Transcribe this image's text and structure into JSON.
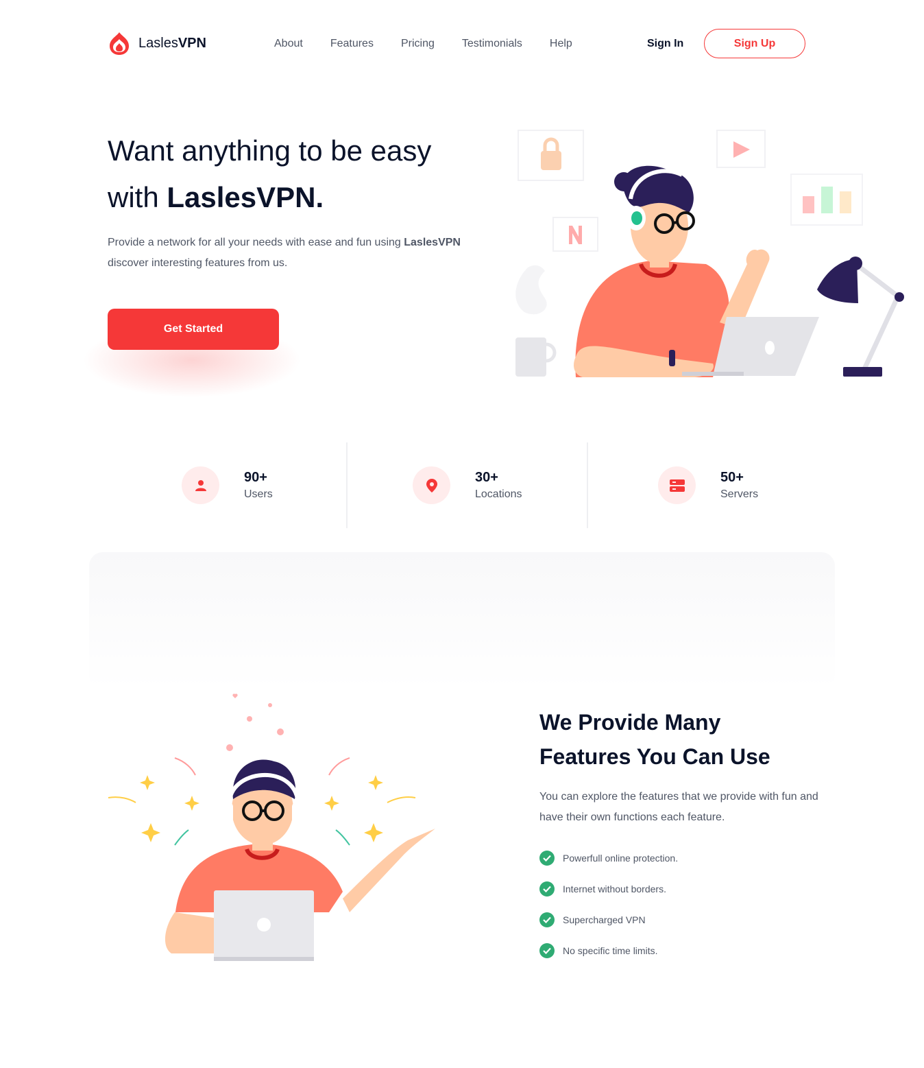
{
  "brand": {
    "name_prefix": "Lasles",
    "name_suffix": "VPN",
    "color": "#f53838"
  },
  "nav": {
    "items": [
      "About",
      "Features",
      "Pricing",
      "Testimonials",
      "Help"
    ]
  },
  "auth": {
    "sign_in": "Sign In",
    "sign_up": "Sign Up"
  },
  "hero": {
    "title_line1": "Want anything to be easy",
    "title_line2_prefix": "with ",
    "title_line2_brand": "LaslesVPN.",
    "subtitle_a": "Provide a network for all your needs with ease and fun using ",
    "subtitle_brand": "LaslesVPN",
    "subtitle_b": " discover interesting features from us.",
    "cta": "Get Started",
    "illustration_icons": [
      "lock-icon",
      "play-icon",
      "netflix-icon",
      "bar-chart-icon",
      "desk-lamp-icon",
      "coffee-mug-icon",
      "laptop-icon"
    ]
  },
  "stats": [
    {
      "value": "90+",
      "label": "Users",
      "icon": "user-icon"
    },
    {
      "value": "30+",
      "label": "Locations",
      "icon": "location-pin-icon"
    },
    {
      "value": "50+",
      "label": "Servers",
      "icon": "server-icon"
    }
  ],
  "features": {
    "title_line1": "We Provide Many",
    "title_line2": "Features You Can Use",
    "subtitle": "You can explore the features that we provide with fun and have their own functions each feature.",
    "items": [
      "Powerfull online protection.",
      "Internet without borders.",
      "Supercharged VPN",
      "No specific time limits."
    ]
  },
  "colors": {
    "accent": "#f53838",
    "heading": "#0b132a",
    "body": "#4f5665",
    "check": "#2fab73",
    "icon_bg": "#ffecec"
  }
}
